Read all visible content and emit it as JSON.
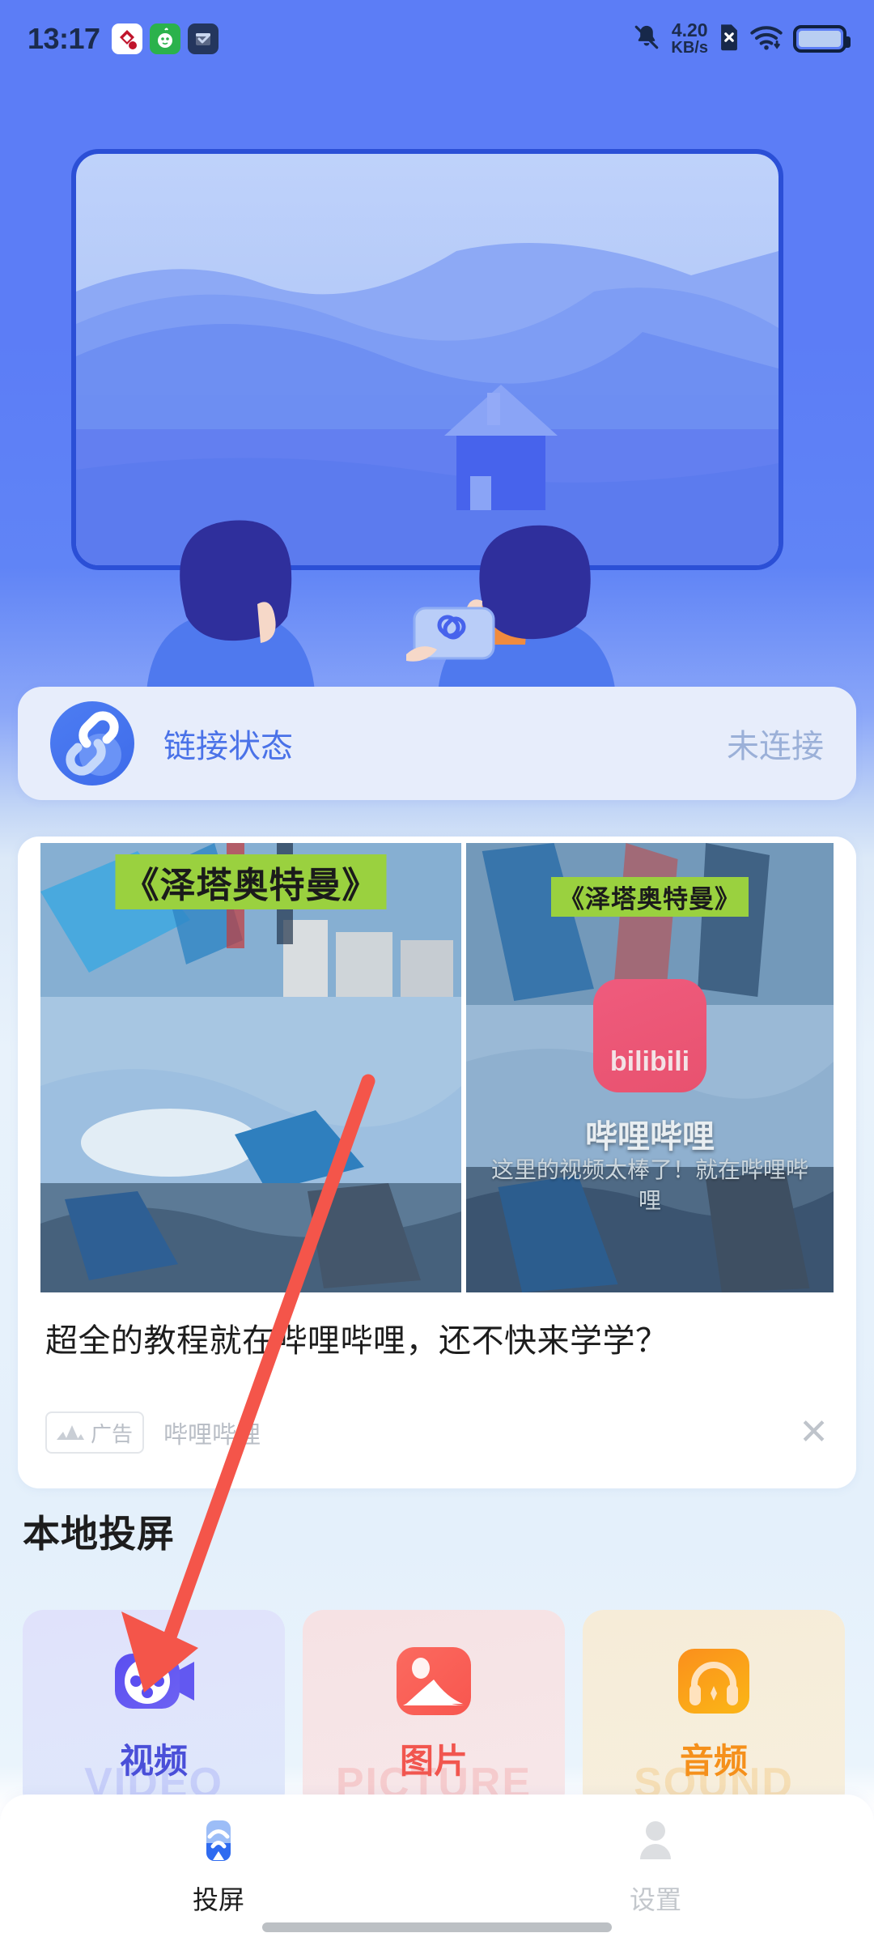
{
  "statusbar": {
    "time": "13:17",
    "network_speed": "4.20",
    "network_unit": "KB/s",
    "icons": {
      "app1": "app-icon-red-diamond",
      "app2": "app-icon-green-mascot",
      "app3": "app-icon-blue-checkbox",
      "mute": "bell-muted-icon",
      "sim": "no-sim-icon",
      "wifi": "wifi-icon",
      "battery": "battery-icon"
    }
  },
  "hero": {
    "alt": "two-people-watching-tv-illustration"
  },
  "link_card": {
    "title": "链接状态",
    "state": "未连接",
    "icon": "chain-link-icon"
  },
  "ad": {
    "image_title_left": "《泽塔奥特曼》",
    "image_title_right": "《泽塔奥特曼》",
    "brand_logo_text": "bilibili",
    "brand_name": "哔哩哔哩",
    "brand_tagline": "这里的视频太棒了！就在哔哩哔哩",
    "headline": "超全的教程就在哔哩哔哩，还不快来学学？",
    "badge_label": "广告",
    "advertiser": "哔哩哔哩",
    "close_label": "✕"
  },
  "section": {
    "title": "本地投屏"
  },
  "media_cards": [
    {
      "label": "视频",
      "watermark": "VIDEO",
      "icon": "video-camera-icon",
      "accent": "#4a4fd8"
    },
    {
      "label": "图片",
      "watermark": "PICTURE",
      "icon": "image-mountain-icon",
      "accent": "#f1564f"
    },
    {
      "label": "音频",
      "watermark": "SOUND",
      "icon": "headphones-icon",
      "accent": "#f5901b"
    }
  ],
  "bottom_nav": [
    {
      "label": "投屏",
      "icon": "cast-icon",
      "active": true
    },
    {
      "label": "设置",
      "icon": "person-icon",
      "active": false
    }
  ],
  "annotation": {
    "type": "red-arrow",
    "color": "#f4554a",
    "points_to": "视频"
  }
}
